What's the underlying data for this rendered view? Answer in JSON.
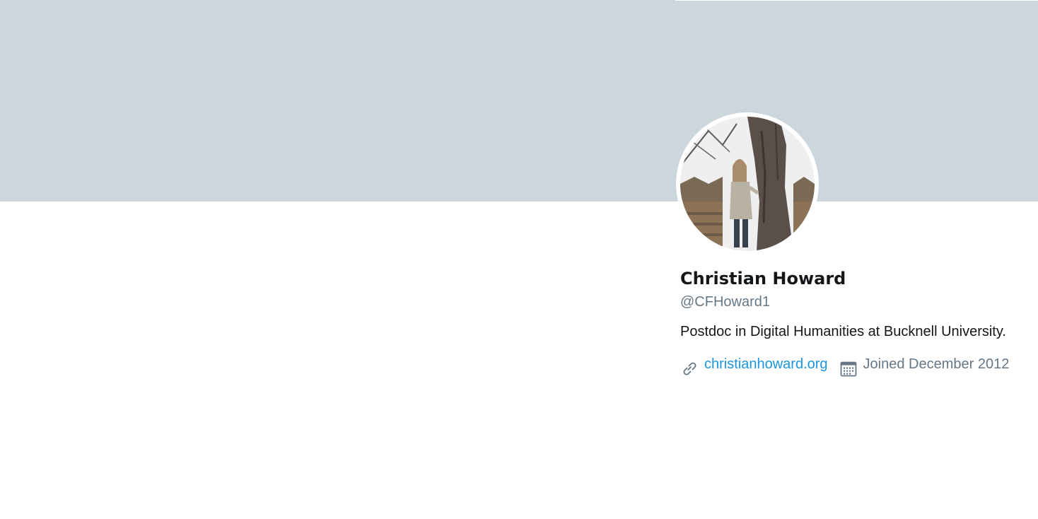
{
  "profile": {
    "display_name": "Christian Howard",
    "handle": "@CFHoward1",
    "bio": "Postdoc in Digital Humanities at Bucknell University.",
    "website": "christianhoward.org",
    "joined": "Joined December 2012"
  },
  "icons": {
    "website": "link-icon",
    "joined": "calendar-icon"
  },
  "colors": {
    "banner": "#ccd6dd",
    "name": "#14171a",
    "secondary": "#657786",
    "link": "#1b95e0"
  }
}
